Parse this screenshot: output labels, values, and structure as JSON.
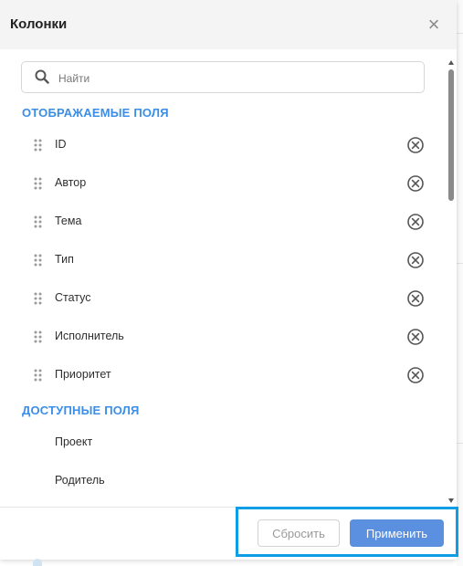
{
  "dialog": {
    "title": "Колонки",
    "close_icon": "close-icon"
  },
  "search": {
    "placeholder": "Найти",
    "value": "",
    "icon": "search-icon"
  },
  "displayed": {
    "title": "ОТОБРАЖАЕМЫЕ ПОЛЯ",
    "fields": [
      "ID",
      "Автор",
      "Тема",
      "Тип",
      "Статус",
      "Исполнитель",
      "Приоритет"
    ]
  },
  "available": {
    "title": "ДОСТУПНЫЕ ПОЛЯ",
    "fields": [
      "Проект",
      "Родитель"
    ]
  },
  "footer": {
    "reset_label": "Сбросить",
    "apply_label": "Применить"
  },
  "colors": {
    "accent": "#3b8ee8",
    "apply_button": "#5b8fdf",
    "highlight": "#0f9ee6"
  }
}
